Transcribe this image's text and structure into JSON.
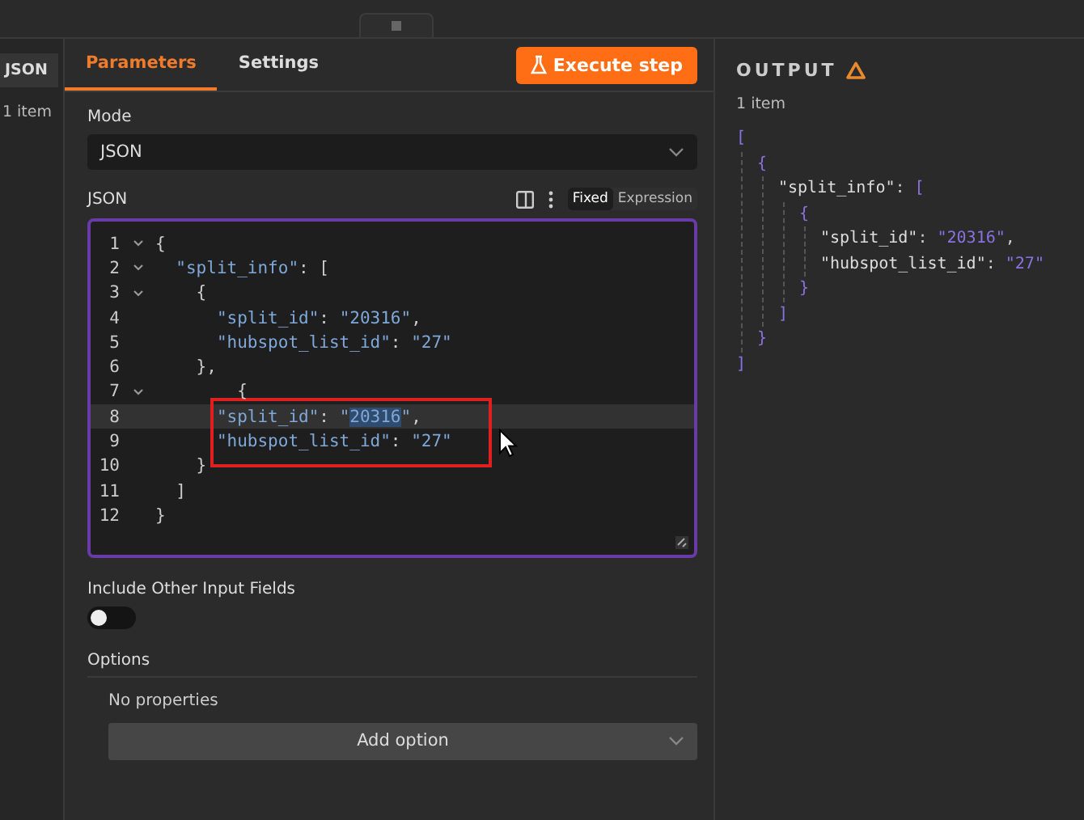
{
  "left_panel": {
    "tab": "JSON",
    "count": "1 item"
  },
  "tabs": [
    {
      "label": "Parameters",
      "selected": true
    },
    {
      "label": "Settings",
      "selected": false
    }
  ],
  "execute_button": "Execute step",
  "mode": {
    "label": "Mode",
    "value": "JSON"
  },
  "json_field": {
    "label": "JSON",
    "toggle": [
      {
        "label": "Fixed",
        "selected": true
      },
      {
        "label": "Expression",
        "selected": false
      }
    ],
    "lines": [
      {
        "number": "1",
        "fold": true,
        "current": false,
        "parts": [
          {
            "text": "{",
            "selected": false
          }
        ]
      },
      {
        "number": "2",
        "fold": true,
        "current": false,
        "parts": [
          {
            "text": "  \"split_info\": [",
            "selected": false
          }
        ]
      },
      {
        "number": "3",
        "fold": true,
        "current": false,
        "parts": [
          {
            "text": "    {",
            "selected": false
          }
        ]
      },
      {
        "number": "4",
        "fold": false,
        "current": false,
        "parts": [
          {
            "text": "      \"split_id\": \"20316\",",
            "selected": false
          }
        ]
      },
      {
        "number": "5",
        "fold": false,
        "current": false,
        "parts": [
          {
            "text": "      \"hubspot_list_id\": \"27\"",
            "selected": false
          }
        ]
      },
      {
        "number": "6",
        "fold": false,
        "current": false,
        "parts": [
          {
            "text": "    },",
            "selected": false
          }
        ]
      },
      {
        "number": "7",
        "fold": true,
        "current": false,
        "parts": [
          {
            "text": "        {",
            "selected": false
          }
        ]
      },
      {
        "number": "8",
        "fold": false,
        "current": true,
        "parts": [
          {
            "text": "      \"split_id\": \"",
            "selected": false
          },
          {
            "text": "20316",
            "selected": true
          },
          {
            "text": "\",",
            "selected": false
          }
        ]
      },
      {
        "number": "9",
        "fold": false,
        "current": false,
        "parts": [
          {
            "text": "      \"hubspot_list_id\": \"27\"",
            "selected": false
          }
        ]
      },
      {
        "number": "10",
        "fold": false,
        "current": false,
        "parts": [
          {
            "text": "    }",
            "selected": false
          }
        ]
      },
      {
        "number": "11",
        "fold": false,
        "current": false,
        "parts": [
          {
            "text": "  ]",
            "selected": false
          }
        ]
      },
      {
        "number": "12",
        "fold": false,
        "current": false,
        "parts": [
          {
            "text": "}",
            "selected": false
          }
        ]
      }
    ]
  },
  "include_other_fields": {
    "label": "Include Other Input Fields",
    "on": false
  },
  "options": {
    "label": "Options",
    "empty_text": "No properties",
    "add_button": "Add option"
  },
  "output": {
    "title": "OUTPUT",
    "count": "1 item",
    "tree": {
      "open": "[",
      "close": "]",
      "children": [
        {
          "open": "{",
          "close": "}",
          "children": [
            {
              "key": "\"split_info\"",
              "sep": ":",
              "open": "[",
              "close": "]",
              "children": [
                {
                  "open": "{",
                  "close": "}",
                  "children": [
                    {
                      "key": "\"split_id\"",
                      "sep": ":",
                      "value": "\"20316\"",
                      "comma": ","
                    },
                    {
                      "key": "\"hubspot_list_id\"",
                      "sep": ":",
                      "value": "\"27\""
                    }
                  ]
                }
              ]
            }
          ]
        }
      ]
    }
  }
}
